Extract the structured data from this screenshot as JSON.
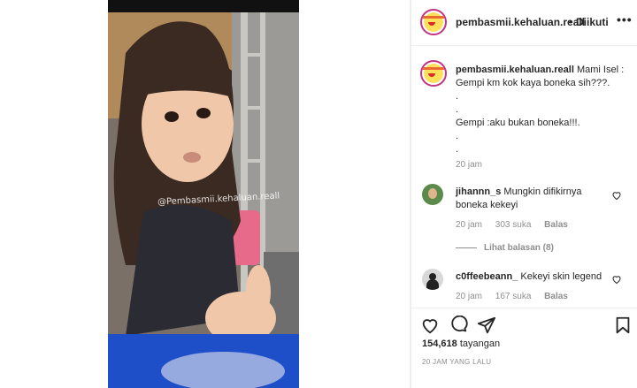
{
  "post": {
    "username": "pembasmii.kehaluan.reall",
    "follow_separator": "•",
    "follow_label": "Diikuti",
    "more_icon": "more-horizontal-icon"
  },
  "video": {
    "watermark": "@Pembasmii.kehaluan.reall"
  },
  "caption": {
    "username": "pembasmii.kehaluan.reall",
    "lines": [
      "Mami Isel :",
      "Gempi km kok kaya boneka sih???.",
      ".",
      ".",
      "Gempi :aku bukan boneka!!!.",
      ".",
      "."
    ],
    "time": "20 jam"
  },
  "comments": [
    {
      "username": "jihannn_s",
      "text": "Mungkin difikirnya boneka kekeyi",
      "time": "20 jam",
      "likes": "303 suka",
      "reply_label": "Balas",
      "view_replies": "Lihat balasan (8)"
    },
    {
      "username": "c0ffeebeann_",
      "text": "Kekeyi skin legend",
      "time": "20 jam",
      "likes": "167 suka",
      "reply_label": "Balas"
    }
  ],
  "stats": {
    "views_count": "154,618",
    "views_label": "tayangan",
    "timestamp": "20 JAM YANG LALU"
  },
  "colors": {
    "text": "#262626",
    "secondary": "#8e8e8e",
    "border": "#efefef",
    "story_ring": "#c13584"
  }
}
